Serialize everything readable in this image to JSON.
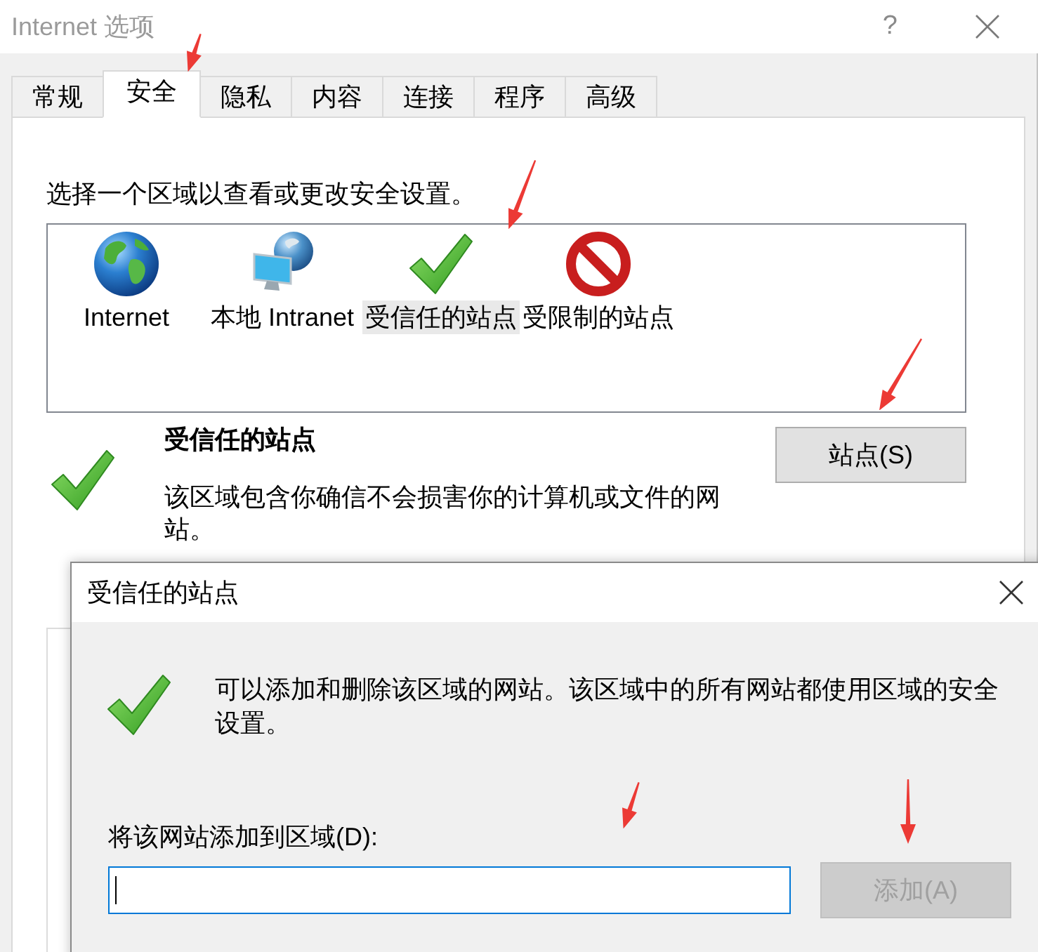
{
  "window": {
    "title": "Internet 选项",
    "help_button": "?"
  },
  "tabs": [
    {
      "label": "常规",
      "selected": false
    },
    {
      "label": "安全",
      "selected": true
    },
    {
      "label": "隐私",
      "selected": false
    },
    {
      "label": "内容",
      "selected": false
    },
    {
      "label": "连接",
      "selected": false
    },
    {
      "label": "程序",
      "selected": false
    },
    {
      "label": "高级",
      "selected": false
    }
  ],
  "security": {
    "instruction": "选择一个区域以查看或更改安全设置。",
    "zones": [
      {
        "kind": "internet",
        "label": "Internet",
        "selected": false
      },
      {
        "kind": "intranet",
        "label": "本地 Intranet",
        "selected": false
      },
      {
        "kind": "trusted",
        "label": "受信任的站点",
        "selected": true
      },
      {
        "kind": "restricted",
        "label": "受限制的站点",
        "selected": false
      }
    ],
    "zone_info": {
      "title": "受信任的站点",
      "description": "该区域包含你确信不会损害你的计算机或文件的网站。"
    },
    "sites_button": {
      "label": "站点(S)",
      "disabled": false
    }
  },
  "dialog": {
    "title": "受信任的站点",
    "message": "可以添加和删除该区域的网站。该区域中的所有网站都使用区域的安全设置。",
    "field_label": "将该网站添加到区域(D):",
    "url_field": {
      "focused": true
    },
    "add_button": {
      "label": "添加(A)",
      "disabled": true
    }
  }
}
